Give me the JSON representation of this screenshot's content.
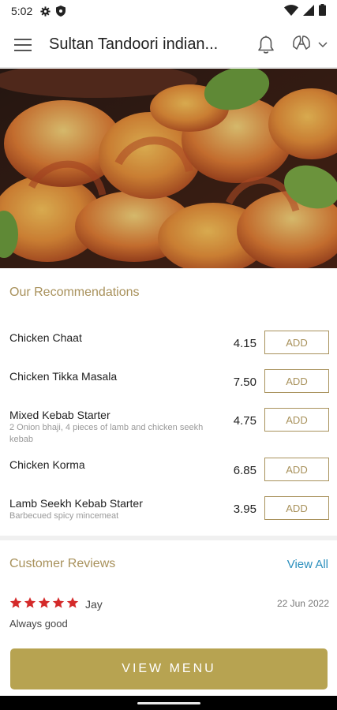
{
  "status_bar": {
    "time": "5:02",
    "icons": [
      "gear-icon",
      "shield-icon",
      "wifi-icon",
      "signal-icon",
      "battery-icon"
    ]
  },
  "app_bar": {
    "title": "Sultan Tandoori indian...",
    "icons": [
      "hamburger-menu-icon",
      "bell-icon",
      "language-icon",
      "chevron-down-icon"
    ]
  },
  "recommendations": {
    "heading": "Our Recommendations",
    "add_label": "ADD",
    "items": [
      {
        "name": "Chicken Chaat",
        "description": "",
        "price": "4.15"
      },
      {
        "name": "Chicken Tikka Masala",
        "description": "",
        "price": "7.50"
      },
      {
        "name": "Mixed Kebab Starter",
        "description": "2 Onion bhaji, 4 pieces of lamb and chicken seekh kebab",
        "price": "4.75"
      },
      {
        "name": "Chicken Korma",
        "description": "",
        "price": "6.85"
      },
      {
        "name": "Lamb Seekh Kebab Starter",
        "description": "Barbecued spicy mincemeat",
        "price": "3.95"
      }
    ]
  },
  "reviews": {
    "heading": "Customer Reviews",
    "view_all": "View All",
    "items": [
      {
        "rating": 5,
        "reviewer": "Jay",
        "date": "22 Jun 2022",
        "comment": "Always good"
      }
    ]
  },
  "footer": {
    "view_menu_label": "VIEW MENU"
  },
  "colors": {
    "accent": "#a8915b",
    "button": "#b7a351",
    "link": "#2b8fbd",
    "star": "#d42a2a"
  }
}
